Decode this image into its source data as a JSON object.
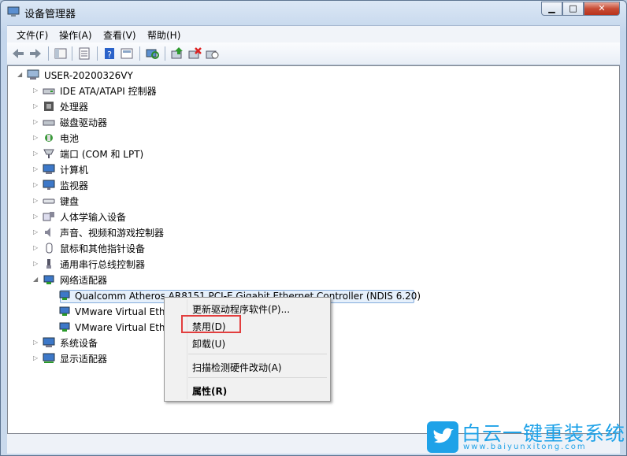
{
  "window": {
    "title": "设备管理器"
  },
  "menu": [
    "文件(F)",
    "操作(A)",
    "查看(V)",
    "帮助(H)"
  ],
  "toolbar_icons": [
    "back-icon",
    "forward-icon",
    "up-icon",
    "properties-icon",
    "help-icon",
    "view-icon",
    "scan-icon",
    "update-driver-icon",
    "uninstall-icon",
    "enable-icon"
  ],
  "tree": {
    "root": "USER-20200326VY",
    "categories": [
      {
        "label": "IDE ATA/ATAPI 控制器",
        "icon": "ide-controller-icon"
      },
      {
        "label": "处理器",
        "icon": "processor-icon"
      },
      {
        "label": "磁盘驱动器",
        "icon": "disk-drive-icon"
      },
      {
        "label": "电池",
        "icon": "battery-icon"
      },
      {
        "label": "端口 (COM 和 LPT)",
        "icon": "port-icon"
      },
      {
        "label": "计算机",
        "icon": "computer-icon"
      },
      {
        "label": "监视器",
        "icon": "monitor-icon"
      },
      {
        "label": "键盘",
        "icon": "keyboard-icon"
      },
      {
        "label": "人体学输入设备",
        "icon": "hid-icon"
      },
      {
        "label": "声音、视频和游戏控制器",
        "icon": "sound-icon"
      },
      {
        "label": "鼠标和其他指针设备",
        "icon": "mouse-icon"
      },
      {
        "label": "通用串行总线控制器",
        "icon": "usb-icon"
      },
      {
        "label": "网络适配器",
        "icon": "network-adapter-icon",
        "expanded": true
      },
      {
        "label": "系统设备",
        "icon": "system-device-icon"
      },
      {
        "label": "显示适配器",
        "icon": "display-adapter-icon"
      }
    ],
    "network_children": [
      "Qualcomm Atheros AR8151 PCI-E Gigabit Ethernet Controller (NDIS 6.20)",
      "VMware Virtual Ethe",
      "VMware Virtual Ethe"
    ]
  },
  "context_menu": {
    "items": [
      "更新驱动程序软件(P)...",
      "禁用(D)",
      "卸载(U)",
      "扫描检测硬件改动(A)",
      "属性(R)"
    ]
  },
  "watermark": {
    "text": "白云一键重装系统",
    "url": "www.baiyunxitong.com"
  }
}
